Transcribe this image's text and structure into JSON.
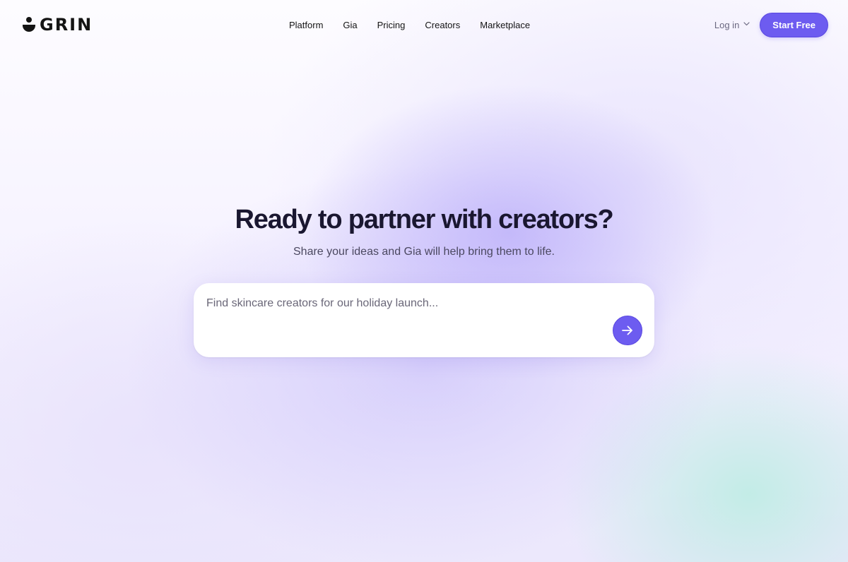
{
  "header": {
    "logo_text": "GRIN",
    "nav": [
      {
        "label": "Platform"
      },
      {
        "label": "Gia"
      },
      {
        "label": "Pricing"
      },
      {
        "label": "Creators"
      },
      {
        "label": "Marketplace"
      }
    ],
    "login_label": "Log in",
    "start_label": "Start Free"
  },
  "hero": {
    "title": "Ready to partner with creators?",
    "subtitle": "Share your ideas and Gia will help bring them to life.",
    "prompt_placeholder": "Find skincare creators for our holiday launch...",
    "prompt_value": ""
  },
  "icons": {
    "logo": "grin-smile-icon",
    "login_caret": "chevron-down-icon",
    "send": "arrow-right-icon"
  },
  "colors": {
    "accent": "#6d5cf0",
    "text": "#1a1730",
    "muted": "#6b6880"
  }
}
